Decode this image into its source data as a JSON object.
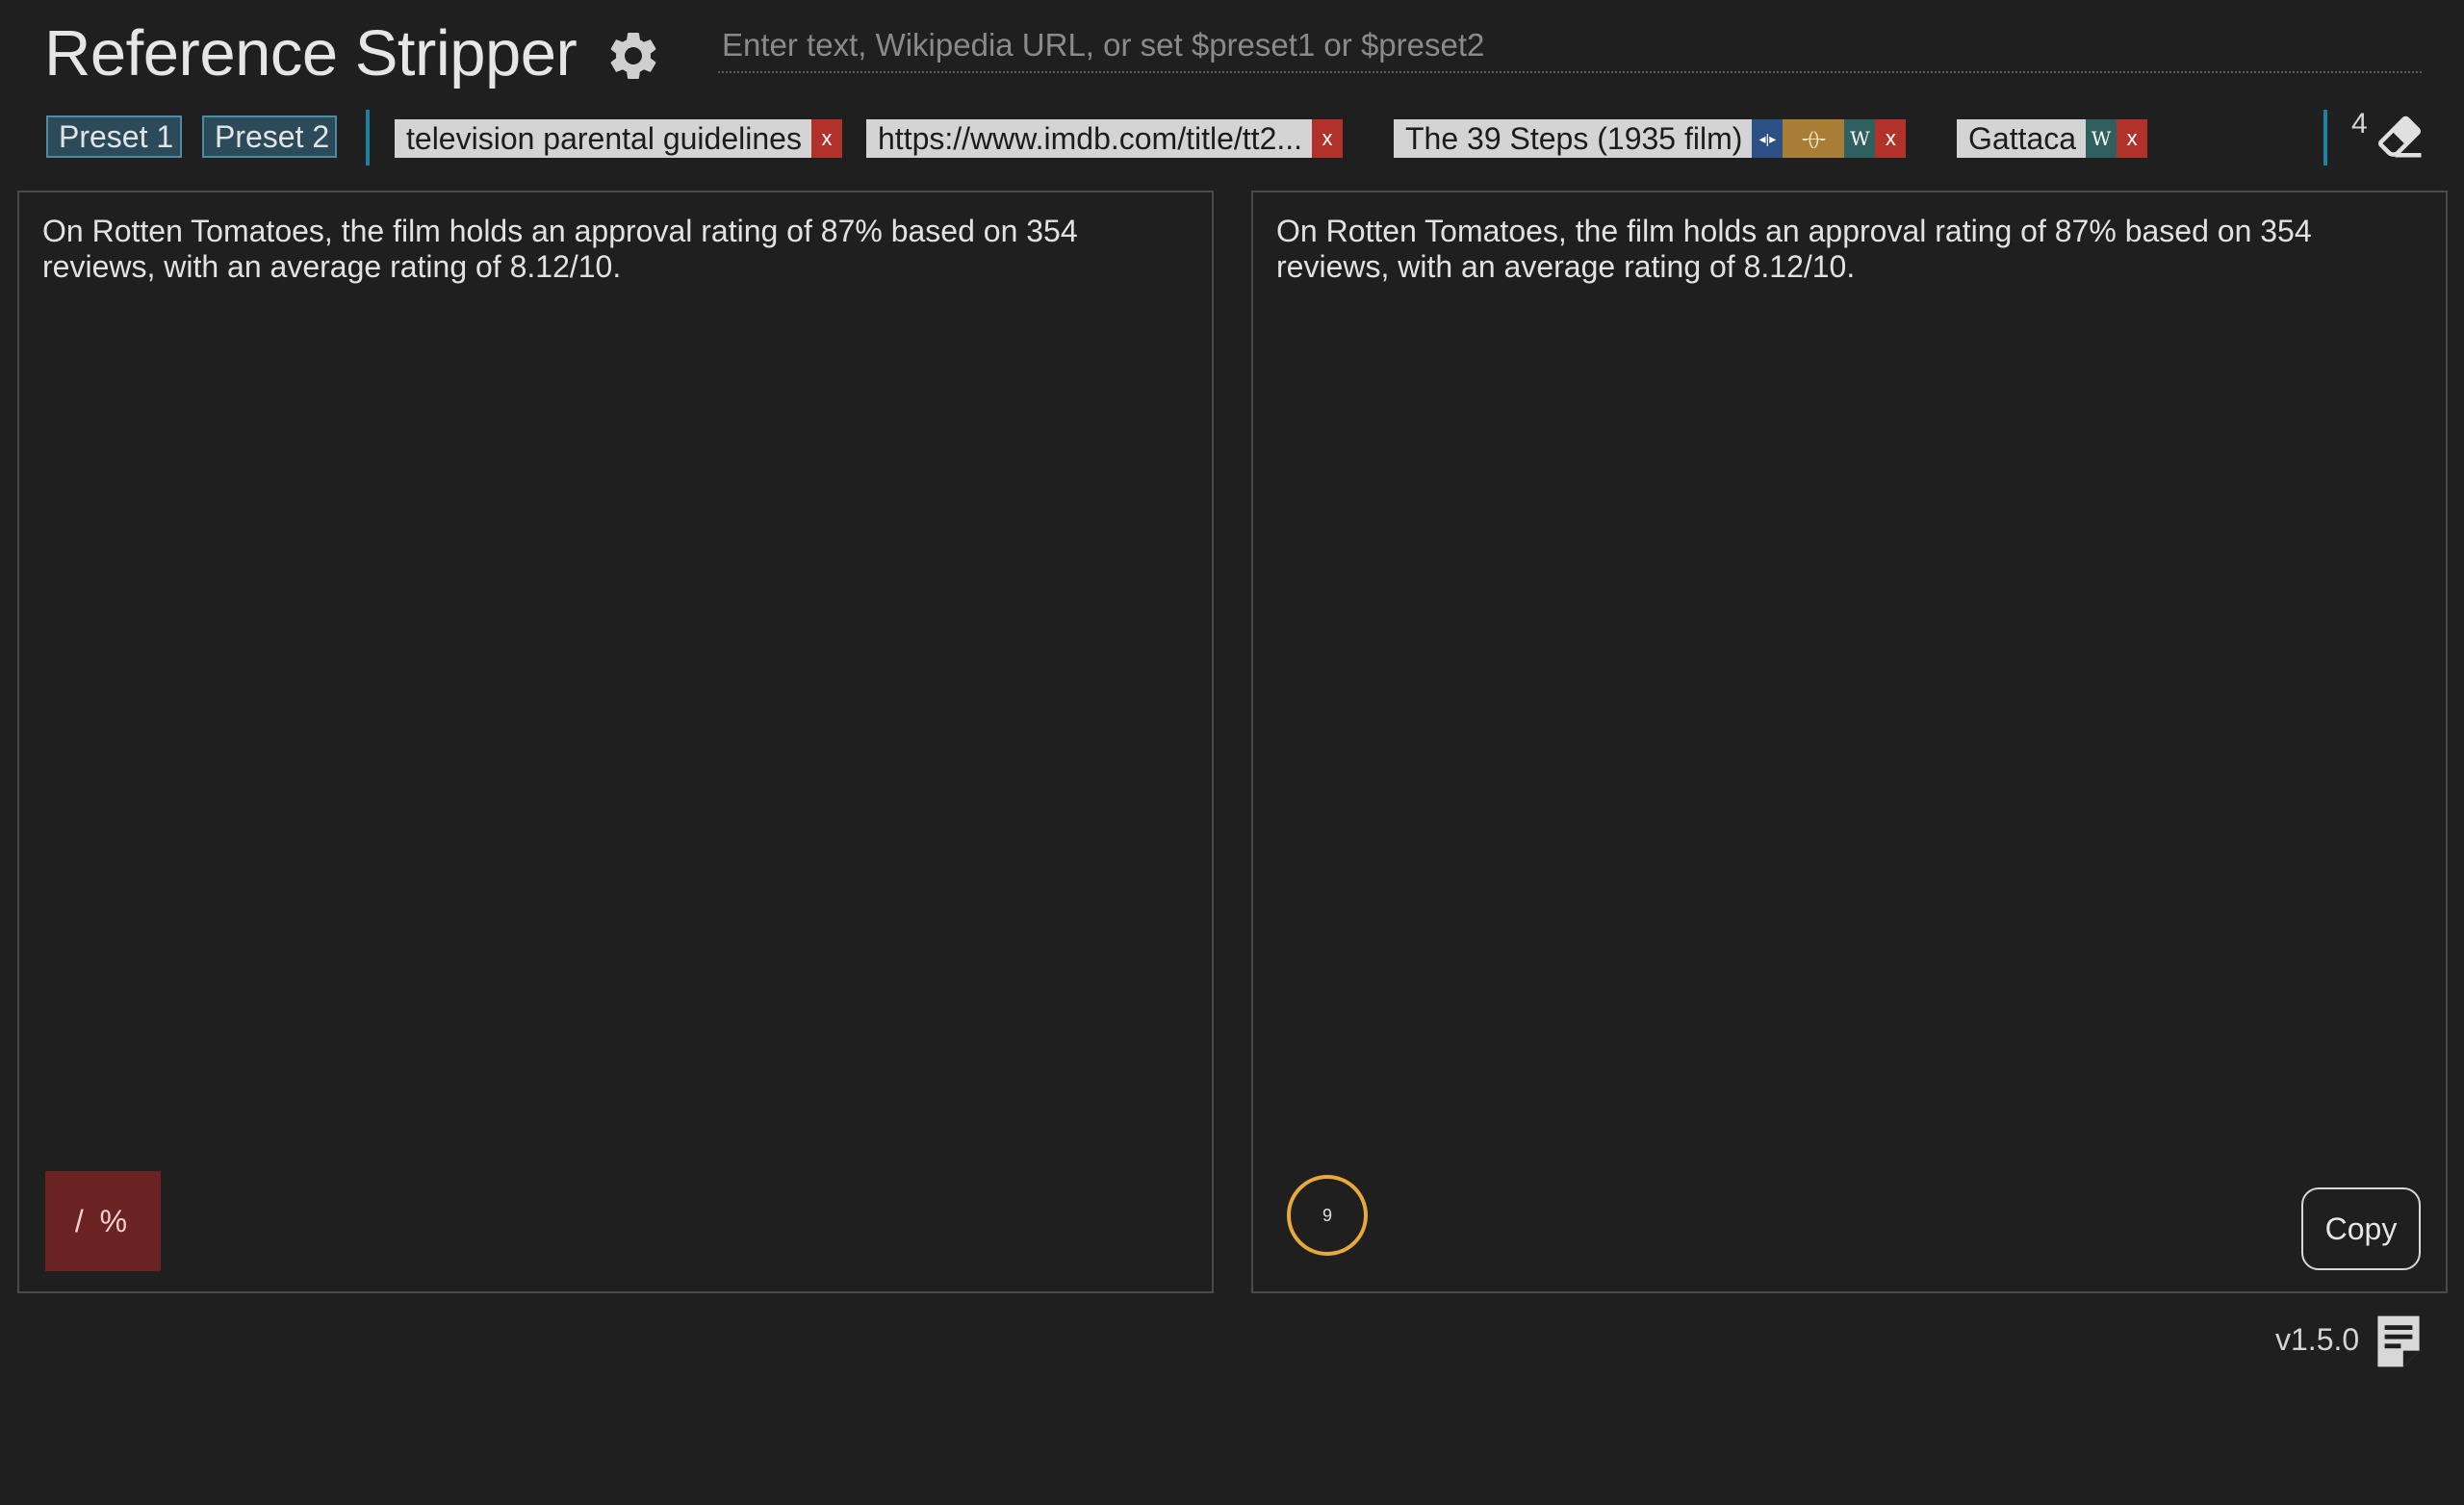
{
  "app": {
    "title": "Reference Stripper",
    "settings_icon": "gear-icon"
  },
  "input": {
    "placeholder": "Enter text, Wikipedia URL, or set $preset1 or $preset2",
    "value": ""
  },
  "presets": [
    {
      "label": "Preset 1"
    },
    {
      "label": "Preset 2"
    }
  ],
  "chips": [
    {
      "label": "television parental guidelines",
      "close_label": "x",
      "actions": []
    },
    {
      "label": "https://www.imdb.com/title/tt2...",
      "close_label": "x",
      "actions": []
    },
    {
      "label": "The 39 Steps (1935 film)",
      "close_label": "x",
      "actions": [
        "expand-icon",
        "strikethrough-brackets-icon",
        "wikipedia-icon"
      ],
      "wiki_label": "W"
    },
    {
      "label": "Gattaca",
      "close_label": "x",
      "actions": [
        "wikipedia-icon"
      ],
      "wiki_label": "W"
    }
  ],
  "history": {
    "count": "4",
    "clear_icon": "eraser-icon"
  },
  "input_panel": {
    "text": "On Rotten Tomatoes, the film holds an approval rating of 87% based on 354 reviews, with an average rating of 8.12/10.",
    "regex_button_label": "/ %"
  },
  "output_panel": {
    "text": "On Rotten Tomatoes, the film holds an approval rating of 87% based on 354 reviews, with an average rating of 8.12/10.",
    "progress_value": "9",
    "copy_label": "Copy"
  },
  "footer": {
    "version": "v1.5.0",
    "notes_icon": "release-notes-icon"
  },
  "colors": {
    "background": "#1f1f1f",
    "accent": "#1f7fa0",
    "close": "#b0322b",
    "progress_ring": "#e8a93c",
    "regex_button": "#6b2222"
  }
}
